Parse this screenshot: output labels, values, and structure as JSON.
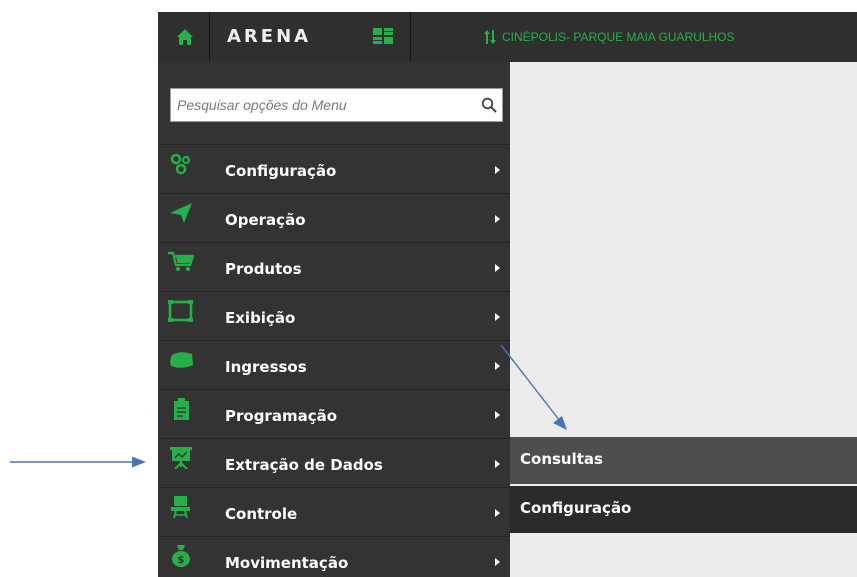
{
  "header": {
    "logo_text": "ARENA",
    "cinema_name": "CINÉPOLIS- PARQUE MAIA GUARULHOS"
  },
  "search": {
    "placeholder": "Pesquisar opções do Menu",
    "value": ""
  },
  "sidebar": {
    "items": [
      {
        "label": "Configuração",
        "icon": "gears-icon"
      },
      {
        "label": "Operação",
        "icon": "navigation-arrow-icon"
      },
      {
        "label": "Produtos",
        "icon": "shopping-cart-icon"
      },
      {
        "label": "Exibição",
        "icon": "screen-frame-icon"
      },
      {
        "label": "Ingressos",
        "icon": "ticket-icon"
      },
      {
        "label": "Programação",
        "icon": "clipboard-icon"
      },
      {
        "label": "Extração de Dados",
        "icon": "presentation-board-icon"
      },
      {
        "label": "Controle",
        "icon": "chair-icon"
      },
      {
        "label": "Movimentação",
        "icon": "money-bag-icon"
      }
    ]
  },
  "submenu": {
    "items": [
      {
        "label": "Consultas",
        "active": true
      },
      {
        "label": "Configuração",
        "active": false
      }
    ]
  },
  "colors": {
    "accent_green": "#25b04a",
    "sidebar_bg": "#333333",
    "topbar_bg": "#2f2f2f",
    "submenu_active": "#4e4e4e",
    "submenu_normal": "#2b2b2b",
    "main_bg": "#ececec",
    "annotation_arrow": "#4a74b8"
  }
}
